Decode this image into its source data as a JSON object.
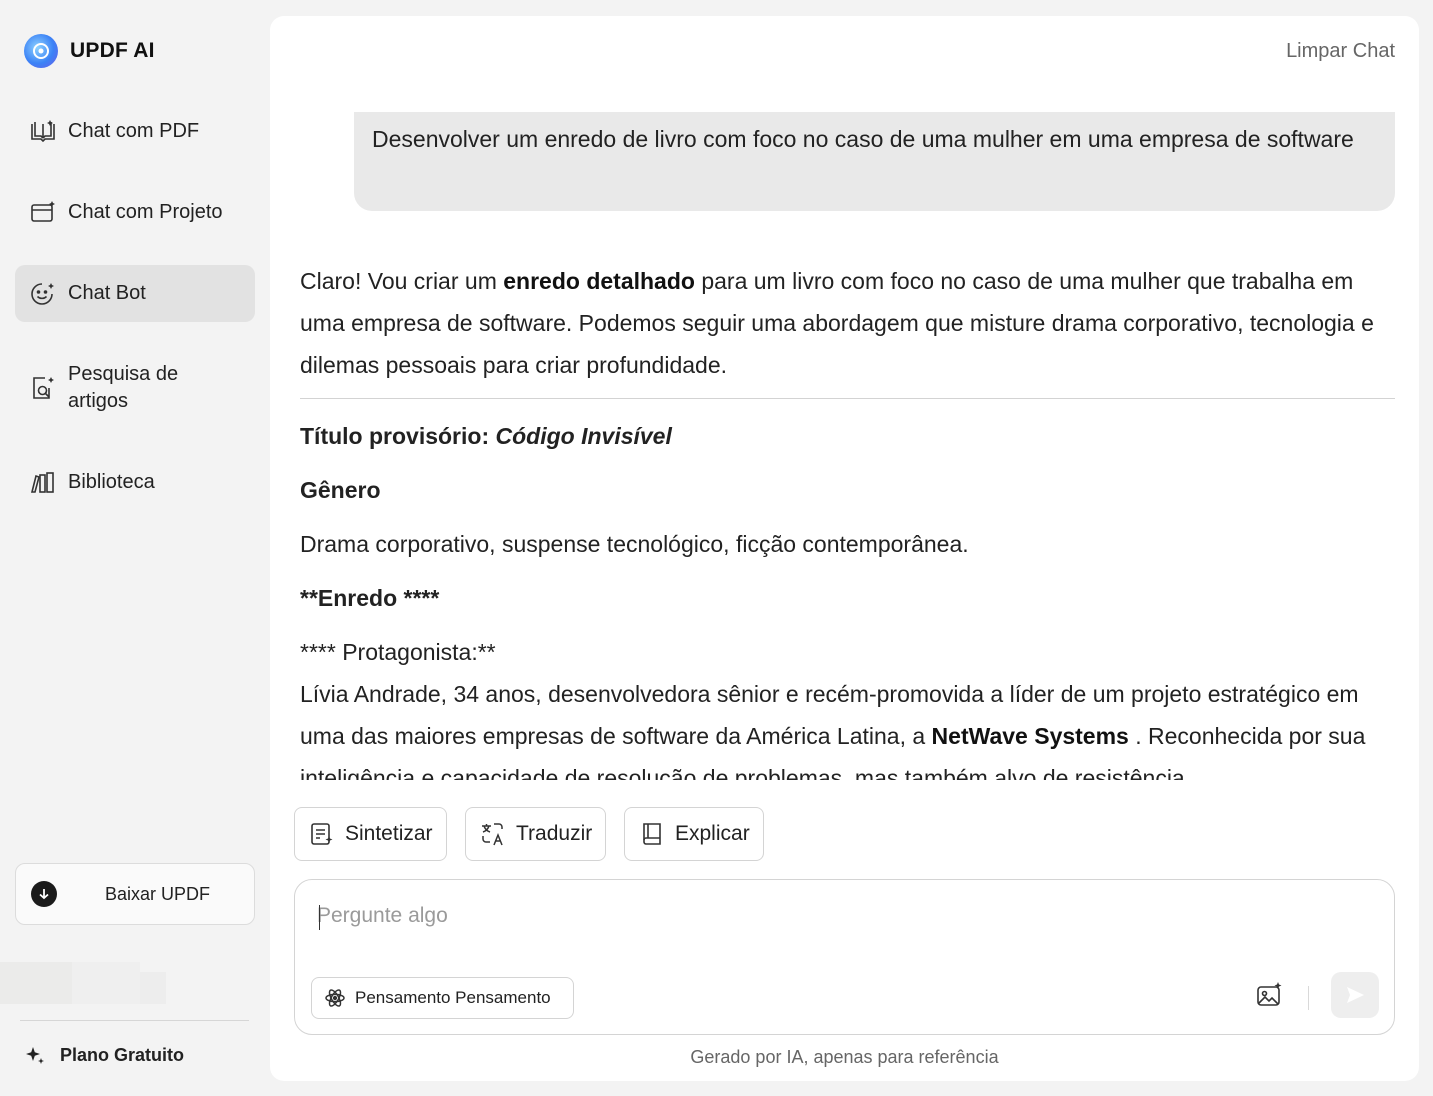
{
  "brand": {
    "name": "UPDF AI"
  },
  "sidebar": {
    "items": [
      {
        "label": "Chat com PDF",
        "icon": "book-open-icon"
      },
      {
        "label": "Chat com Projeto",
        "icon": "folder-sparkle-icon"
      },
      {
        "label": "Chat Bot",
        "icon": "bot-face-icon",
        "active": true
      },
      {
        "label": "Pesquisa de artigos",
        "icon": "doc-search-icon"
      },
      {
        "label": "Biblioteca",
        "icon": "library-icon"
      }
    ],
    "download_label": "Baixar UPDF",
    "plan_label": "Plano Gratuito"
  },
  "header": {
    "clear_chat": "Limpar Chat"
  },
  "chat": {
    "user_message": "Desenvolver um enredo de livro com foco no caso de uma mulher em uma empresa de software",
    "response": {
      "intro_a": "Claro! Vou criar um ",
      "intro_bold": "enredo detalhado",
      "intro_b": " para um livro com foco no caso de uma mulher que trabalha em uma empresa de software. Podemos seguir uma abordagem que misture drama corporativo, tecnologia e dilemas pessoais para criar profundidade.",
      "title_label": "Título provisório: ",
      "title_value": "Código Invisível",
      "genre_heading": "Gênero",
      "genre_text": "Drama corporativo, suspense tecnológico, ficção contemporânea.",
      "plot_heading": "**Enredo ****",
      "protagonist_label": "**** Protagonista:**",
      "protagonist_a": "Lívia Andrade, 34 anos, desenvolvedora sênior e recém-promovida a líder de um projeto estratégico em uma das maiores empresas de software da América Latina, a ",
      "protagonist_bold": "NetWave Systems",
      "protagonist_b": " . Reconhecida por sua inteligência e capacidade de resolução de problemas, mas também alvo de resistência"
    }
  },
  "actions": [
    {
      "label": "Sintetizar",
      "icon": "summarize-icon"
    },
    {
      "label": "Traduzir",
      "icon": "translate-icon"
    },
    {
      "label": "Explicar",
      "icon": "book-icon"
    }
  ],
  "composer": {
    "placeholder": "Pergunte algo",
    "thinking_label": "Pensamento Pensamento"
  },
  "footer": {
    "note": "Gerado por IA, apenas para referência"
  },
  "colors": {
    "active_bg": "#e2e2e2",
    "panel_bg": "#ffffff",
    "app_bg": "#f3f3f3"
  }
}
